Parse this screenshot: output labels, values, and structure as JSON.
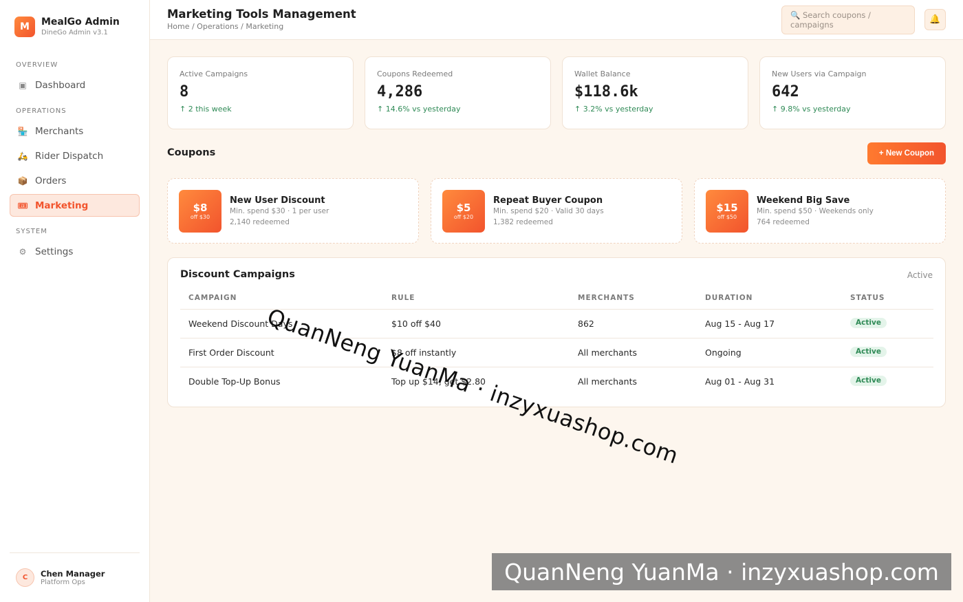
{
  "brand": {
    "logo_letter": "M",
    "name": "MealGo Admin",
    "version": "DineGo Admin v3.1"
  },
  "sidebar": {
    "sections": [
      {
        "label": "OVERVIEW"
      },
      {
        "label": "OPERATIONS"
      },
      {
        "label": "SYSTEM"
      }
    ],
    "items": [
      {
        "label": "Dashboard",
        "icon": "dashboard-icon",
        "glyph": "▣"
      },
      {
        "label": "Merchants",
        "icon": "store-icon",
        "glyph": "🏪"
      },
      {
        "label": "Rider Dispatch",
        "icon": "scooter-icon",
        "glyph": "🛵"
      },
      {
        "label": "Orders",
        "icon": "package-icon",
        "glyph": "📦"
      },
      {
        "label": "Marketing",
        "icon": "ticket-icon",
        "glyph": "🎟"
      },
      {
        "label": "Settings",
        "icon": "gear-icon",
        "glyph": "⚙"
      }
    ],
    "active_item": "Marketing",
    "user": {
      "initial": "C",
      "name": "Chen Manager",
      "role": "Platform Ops"
    }
  },
  "header": {
    "title": "Marketing Tools Management",
    "breadcrumb": "Home / Operations / Marketing",
    "search_placeholder": "🔍 Search coupons / campaigns",
    "bell_glyph": "🔔"
  },
  "stats": [
    {
      "label": "Active Campaigns",
      "value": "8",
      "trend": "↑ 2 this week"
    },
    {
      "label": "Coupons Redeemed",
      "value": "4,286",
      "trend": "↑ 14.6% vs yesterday"
    },
    {
      "label": "Wallet Balance",
      "value": "$118.6k",
      "trend": "↑ 3.2% vs yesterday"
    },
    {
      "label": "New Users via Campaign",
      "value": "642",
      "trend": "↑ 9.8% vs yesterday"
    }
  ],
  "coupons": {
    "title": "Coupons",
    "new_button": "+ New Coupon",
    "items": [
      {
        "amount": "$8",
        "off": "off $30",
        "title": "New User Discount",
        "rule": "Min. spend $30 · 1 per user",
        "redeemed": "2,140 redeemed"
      },
      {
        "amount": "$5",
        "off": "off $20",
        "title": "Repeat Buyer Coupon",
        "rule": "Min. spend $20 · Valid 30 days",
        "redeemed": "1,382 redeemed"
      },
      {
        "amount": "$15",
        "off": "off $50",
        "title": "Weekend Big Save",
        "rule": "Min. spend $50 · Weekends only",
        "redeemed": "764 redeemed"
      }
    ]
  },
  "campaigns": {
    "title": "Discount Campaigns",
    "filter": "Active",
    "columns": [
      "CAMPAIGN",
      "RULE",
      "MERCHANTS",
      "DURATION",
      "STATUS"
    ],
    "rows": [
      {
        "campaign": "Weekend Discount Days",
        "rule": "$10 off $40",
        "merchants": "862",
        "duration": "Aug 15 - Aug 17",
        "status": "Active"
      },
      {
        "campaign": "First Order Discount",
        "rule": "$8 off instantly",
        "merchants": "All merchants",
        "duration": "Ongoing",
        "status": "Active"
      },
      {
        "campaign": "Double Top-Up Bonus",
        "rule": "Top up $14, get $2.80",
        "merchants": "All merchants",
        "duration": "Aug 01 - Aug 31",
        "status": "Active"
      }
    ]
  },
  "watermark": {
    "text": "QuanNeng YuanMa · inzyxuashop.com"
  },
  "colors": {
    "accent": "#f2542d",
    "accent_light": "#fde8de",
    "success": "#2f8a56",
    "background": "#fdf6ee"
  }
}
